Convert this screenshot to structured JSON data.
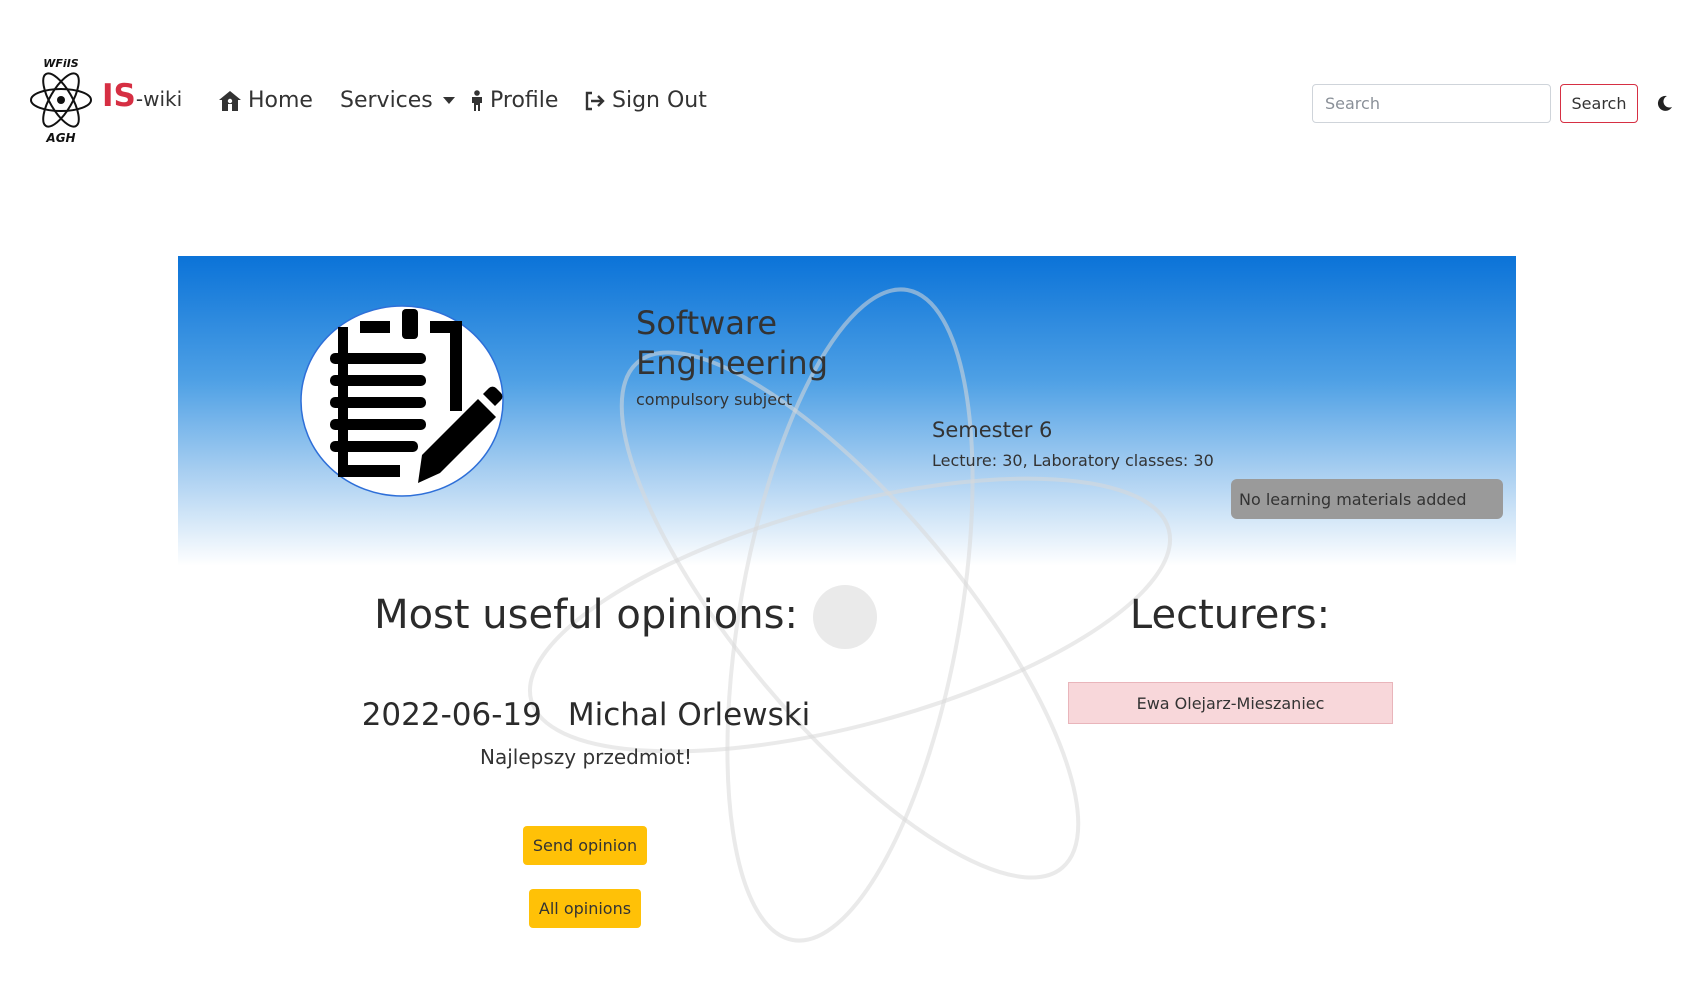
{
  "brand": {
    "prefix": "IS",
    "suffix": "-wiki",
    "logo_top_text": "WFiIS",
    "logo_bottom_text": "AGH",
    "accent_color": "#d62f43"
  },
  "nav": {
    "home": "Home",
    "services": "Services",
    "profile": "Profile",
    "sign_out": "Sign Out"
  },
  "search": {
    "placeholder": "Search",
    "value": "",
    "button_label": "Search"
  },
  "subject": {
    "title": "Software Engineering",
    "type": "compulsory subject",
    "semester": "Semester 6",
    "hours": "Lecture: 30, Laboratory classes: 30",
    "materials_status": "No learning materials added"
  },
  "opinions": {
    "title": "Most useful opinions:",
    "items": [
      {
        "date": "2022-06-19",
        "author": "Michal Orlewski",
        "text": "Najlepszy przedmiot!"
      }
    ],
    "send_button": "Send opinion",
    "all_button": "All opinions"
  },
  "lecturers": {
    "title": "Lecturers:",
    "items": [
      "Ewa Olejarz-Mieszaniec"
    ]
  },
  "colors": {
    "hero_top": "#0b73d8",
    "warning": "#ffc107",
    "lecturer_bg": "#f8d7da",
    "badge_bg": "#9a9a9a"
  }
}
